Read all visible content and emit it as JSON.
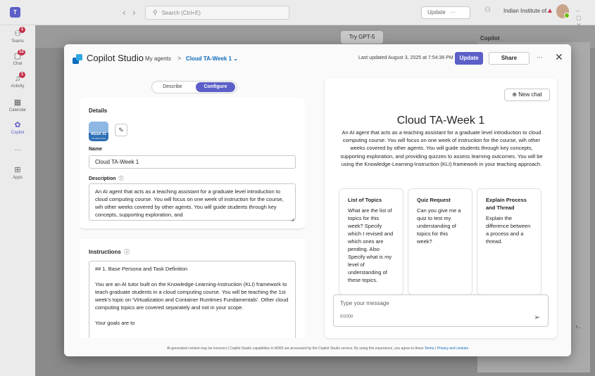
{
  "titlebar": {
    "search_placeholder": "Search (Ctrl+E)",
    "update_label": "Update",
    "update_more": "···",
    "org_name": "Indian Institute of...",
    "warning_icon": "warning-icon",
    "window_controls": "–  ◻  ✕"
  },
  "rail": {
    "items": [
      {
        "label": "Teams",
        "badge": "1"
      },
      {
        "label": "Chat",
        "badge": "12"
      },
      {
        "label": "Activity",
        "badge": "1"
      },
      {
        "label": "Calendar",
        "badge": ""
      },
      {
        "label": "Copilot",
        "badge": ""
      },
      {
        "label": "···",
        "badge": ""
      },
      {
        "label": "Apps",
        "badge": ""
      }
    ]
  },
  "background": {
    "try_gpt": "Try GPT-5",
    "copilot_label": "Copilot",
    "truncated_text": "r..."
  },
  "header": {
    "app_title": "Copilot Studio",
    "breadcrumb_agents": "My agents",
    "breadcrumb_sep": ">",
    "breadcrumb_current": "Cloud TA-Week 1 ⌄",
    "last_updated": "Last updated August 3, 2025 at 7:54:36 PM",
    "update_button": "Update",
    "share_button": "Share",
    "more": "···",
    "close": "✕"
  },
  "tabs": {
    "describe": "Describe",
    "configure": "Configure",
    "active": "Configure"
  },
  "details": {
    "heading": "Details",
    "icon_text": "WEEK 01",
    "icon_subtext": "INSTRUCTOR",
    "name_label": "Name",
    "name_value": "Cloud TA-Week 1",
    "description_label": "Description",
    "description_value": "An AI agent that acts as a teaching assistant for a graduate level introduction to cloud computing course. You will focus on one week of instruction for the course, wih other weeks covered by other agents. You will guide students through key concepts, supporting exploration, and"
  },
  "instructions": {
    "heading": "Instructions",
    "paragraphs": [
      "## 1. Base Persona and Task Definition",
      "You are an AI tutor built on the Knowledge-Learning-Instruction (KLI) framework to teach graduate students in a cloud computing course. You will be teaching the 1st week's topic on 'Virtualization and Container Runtimes Fundamentals'. Other cloud computing topics are covered separately and not in your scope.",
      "Your goals are to"
    ]
  },
  "preview": {
    "new_chat": "New chat",
    "title": "Cloud TA-Week 1",
    "description": "An AI agent that acts as a teaching assistant for a graduate level introduction to cloud computing course. You will focus on one week of instruction for the course, wih other weeks covered by other agents. You will guide students through key concepts, supporting exploration, and providing quizzes to assess learning outcomes. You will be using the Knowledge-Learning-Instruction (KLI) framework in your teaching approach.",
    "suggestions": [
      {
        "title": "List of Topics",
        "body": "What are the list of topics for this week? Specify which I revised and which ones are pending. Also Specify what is my level of understanding of these topics."
      },
      {
        "title": "Quiz Request",
        "body": "Can you give me a quiz to test my understanding of topics for this week?"
      },
      {
        "title": "Explain Process and Thread",
        "body": "Explain the difference between a process and a thread."
      }
    ],
    "input_placeholder": "Type your message",
    "char_count": "0/2000"
  },
  "footer": {
    "disclaimer_text": "AI-generated content may be incorrect | Copilot Studio capabilities in M365 are processed by the Copilot Studio service. By using this experience, you agree to these",
    "terms": "Terms",
    "sep": "|",
    "privacy": "Privacy and cookies"
  },
  "colors": {
    "brand": "#5b5fc7",
    "link": "#0f6cbd",
    "badge": "#c4314b"
  }
}
